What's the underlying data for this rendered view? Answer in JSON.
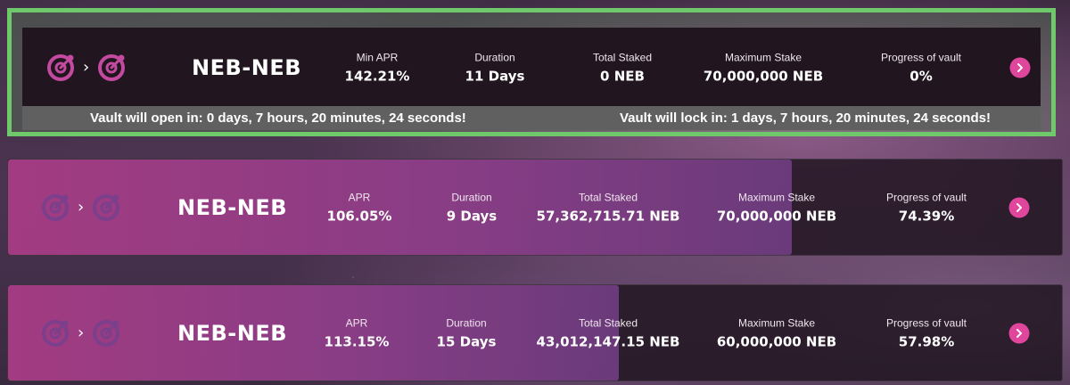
{
  "featured": {
    "pair": "NEB-NEB",
    "apr_label": "Min APR",
    "apr": "142.21%",
    "duration_label": "Duration",
    "duration": "11 Days",
    "staked_label": "Total Staked",
    "staked": "0 NEB",
    "max_label": "Maximum Stake",
    "max": "70,000,000 NEB",
    "progress_label": "Progress of vault",
    "progress": "0%",
    "open_text": "Vault will open in: 0 days, 7 hours, 20 minutes, 24 seconds!",
    "lock_text": "Vault will lock in: 1 days, 7 hours, 20 minutes, 24 seconds!"
  },
  "vaults": [
    {
      "pair": "NEB-NEB",
      "apr_label": "APR",
      "apr": "106.05%",
      "duration_label": "Duration",
      "duration": "9 Days",
      "staked_label": "Total Staked",
      "staked": "57,362,715.71 NEB",
      "max_label": "Maximum Stake",
      "max": "70,000,000 NEB",
      "progress_label": "Progress of vault",
      "progress": "74.39%",
      "progress_fraction": 0.7439
    },
    {
      "pair": "NEB-NEB",
      "apr_label": "APR",
      "apr": "113.15%",
      "duration_label": "Duration",
      "duration": "15 Days",
      "staked_label": "Total Staked",
      "staked": "43,012,147.15 NEB",
      "max_label": "Maximum Stake",
      "max": "60,000,000 NEB",
      "progress_label": "Progress of vault",
      "progress": "57.98%",
      "progress_fraction": 0.5798
    }
  ],
  "icons": {
    "token": "neb-token-icon",
    "arrow": "chevron-right-icon",
    "action": "arrow-right-circle-icon"
  },
  "colors": {
    "accent": "#e0469b",
    "highlight_border": "#6fc96a",
    "progress_fill": "#a93d86",
    "card_bg": "#21161f",
    "countdown_bar": "#606060"
  }
}
